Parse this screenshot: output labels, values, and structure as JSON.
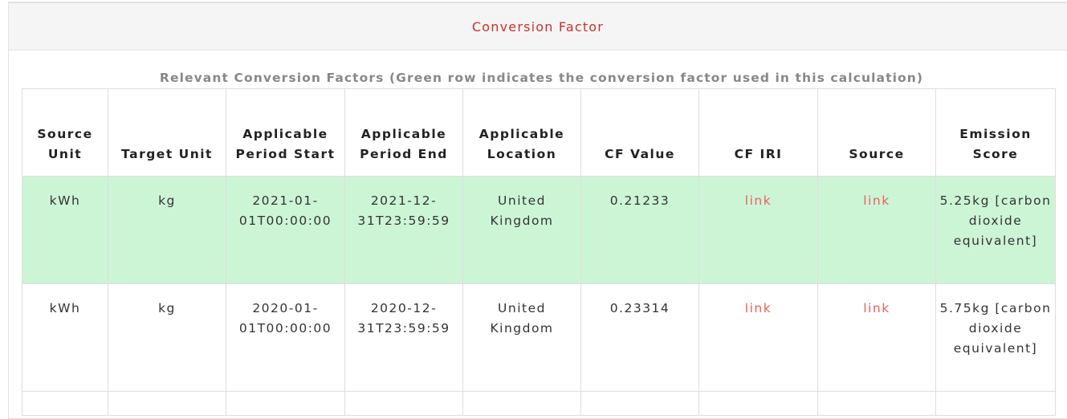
{
  "panel": {
    "title": "Conversion Factor"
  },
  "table": {
    "caption": "Relevant Conversion Factors (Green row indicates the conversion factor used in this calculation)",
    "headers": {
      "source_unit": "Source Unit",
      "target_unit": "Target Unit",
      "period_start": "Applicable Period Start",
      "period_end": "Applicable Period End",
      "location": "Applicable Location",
      "cf_value": "CF Value",
      "cf_iri": "CF IRI",
      "source": "Source",
      "emission_score": "Emission Score"
    },
    "rows": [
      {
        "used": true,
        "source_unit": "kWh",
        "target_unit": "kg",
        "period_start": "2021-01-01T00:00:00",
        "period_end": "2021-12-31T23:59:59",
        "location": "United Kingdom",
        "cf_value": "0.21233",
        "cf_iri": "link",
        "source": "link",
        "emission_score": "5.25kg [carbon dioxide equivalent]"
      },
      {
        "used": false,
        "source_unit": "kWh",
        "target_unit": "kg",
        "period_start": "2020-01-01T00:00:00",
        "period_end": "2020-12-31T23:59:59",
        "location": "United Kingdom",
        "cf_value": "0.23314",
        "cf_iri": "link",
        "source": "link",
        "emission_score": "5.75kg [carbon dioxide equivalent]"
      }
    ]
  },
  "colors": {
    "title_red": "#c9302c",
    "link_red": "#e8615b",
    "used_row_green": "#ccf5d6"
  }
}
